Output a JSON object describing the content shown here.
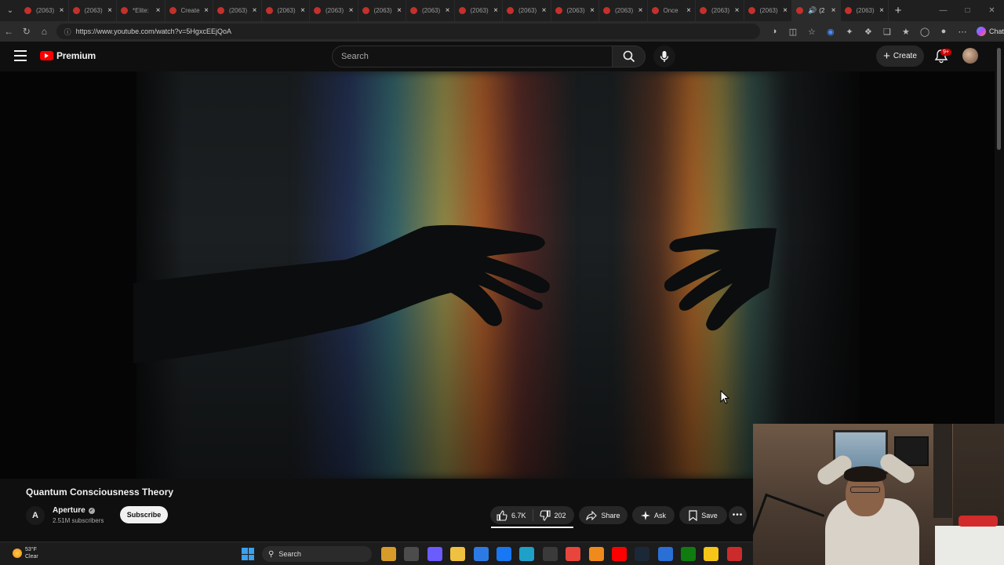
{
  "browser": {
    "tabs": [
      {
        "label": "(2063)"
      },
      {
        "label": "(2063)"
      },
      {
        "label": "*Elite:"
      },
      {
        "label": "Create"
      },
      {
        "label": "(2063)"
      },
      {
        "label": "(2063)"
      },
      {
        "label": "(2063)"
      },
      {
        "label": "(2063)"
      },
      {
        "label": "(2063)"
      },
      {
        "label": "(2063)"
      },
      {
        "label": "(2063)"
      },
      {
        "label": "(2063)"
      },
      {
        "label": "(2063)"
      },
      {
        "label": "Once"
      },
      {
        "label": "(2063)"
      },
      {
        "label": "(2063)"
      },
      {
        "label": "(2"
      },
      {
        "label": "(2063)"
      }
    ],
    "url": "https://www.youtube.com/watch?v=5HgxcEEjQoA",
    "chat_label": "Chat"
  },
  "youtube": {
    "logo_text": "Premium",
    "search_placeholder": "Search",
    "create_label": "Create",
    "notification_badge": "9+",
    "video": {
      "title": "Quantum Consciousness Theory",
      "channel": {
        "name": "Aperture",
        "avatar_letter": "A",
        "subscribers": "2.51M subscribers",
        "subscribe_label": "Subscribe"
      },
      "likes": "6.7K",
      "dislikes": "202",
      "share_label": "Share",
      "ask_label": "Ask",
      "save_label": "Save"
    }
  },
  "taskbar": {
    "temperature": "53°F",
    "condition": "Clear",
    "search_label": "Search",
    "apps": [
      {
        "icon": "file-explorer-icon",
        "color": "#d79b2a"
      },
      {
        "icon": "task-view-icon",
        "color": "#4c4c4c"
      },
      {
        "icon": "copilot-icon",
        "color": "#6a5cff"
      },
      {
        "icon": "folder-icon",
        "color": "#f0c040"
      },
      {
        "icon": "store-icon",
        "color": "#2c7be5"
      },
      {
        "icon": "facebook-icon",
        "color": "#1877f2"
      },
      {
        "icon": "edge-icon",
        "color": "#1fa0c9"
      },
      {
        "icon": "calculator-icon",
        "color": "#3a3a3a"
      },
      {
        "icon": "chrome-icon",
        "color": "#e8453c"
      },
      {
        "icon": "vlc-icon",
        "color": "#f08a1c"
      },
      {
        "icon": "youtube-icon",
        "color": "#ff0000"
      },
      {
        "icon": "steam-icon",
        "color": "#1b2838"
      },
      {
        "icon": "app-icon",
        "color": "#2a6fd6"
      },
      {
        "icon": "xbox-icon",
        "color": "#107c10"
      },
      {
        "icon": "notes-icon",
        "color": "#f5c518"
      },
      {
        "icon": "settings-icon",
        "color": "#cc2b2b"
      }
    ]
  },
  "colors": {
    "background": "#0f0f0f",
    "accent": "#ff0000",
    "pill": "#272727"
  }
}
